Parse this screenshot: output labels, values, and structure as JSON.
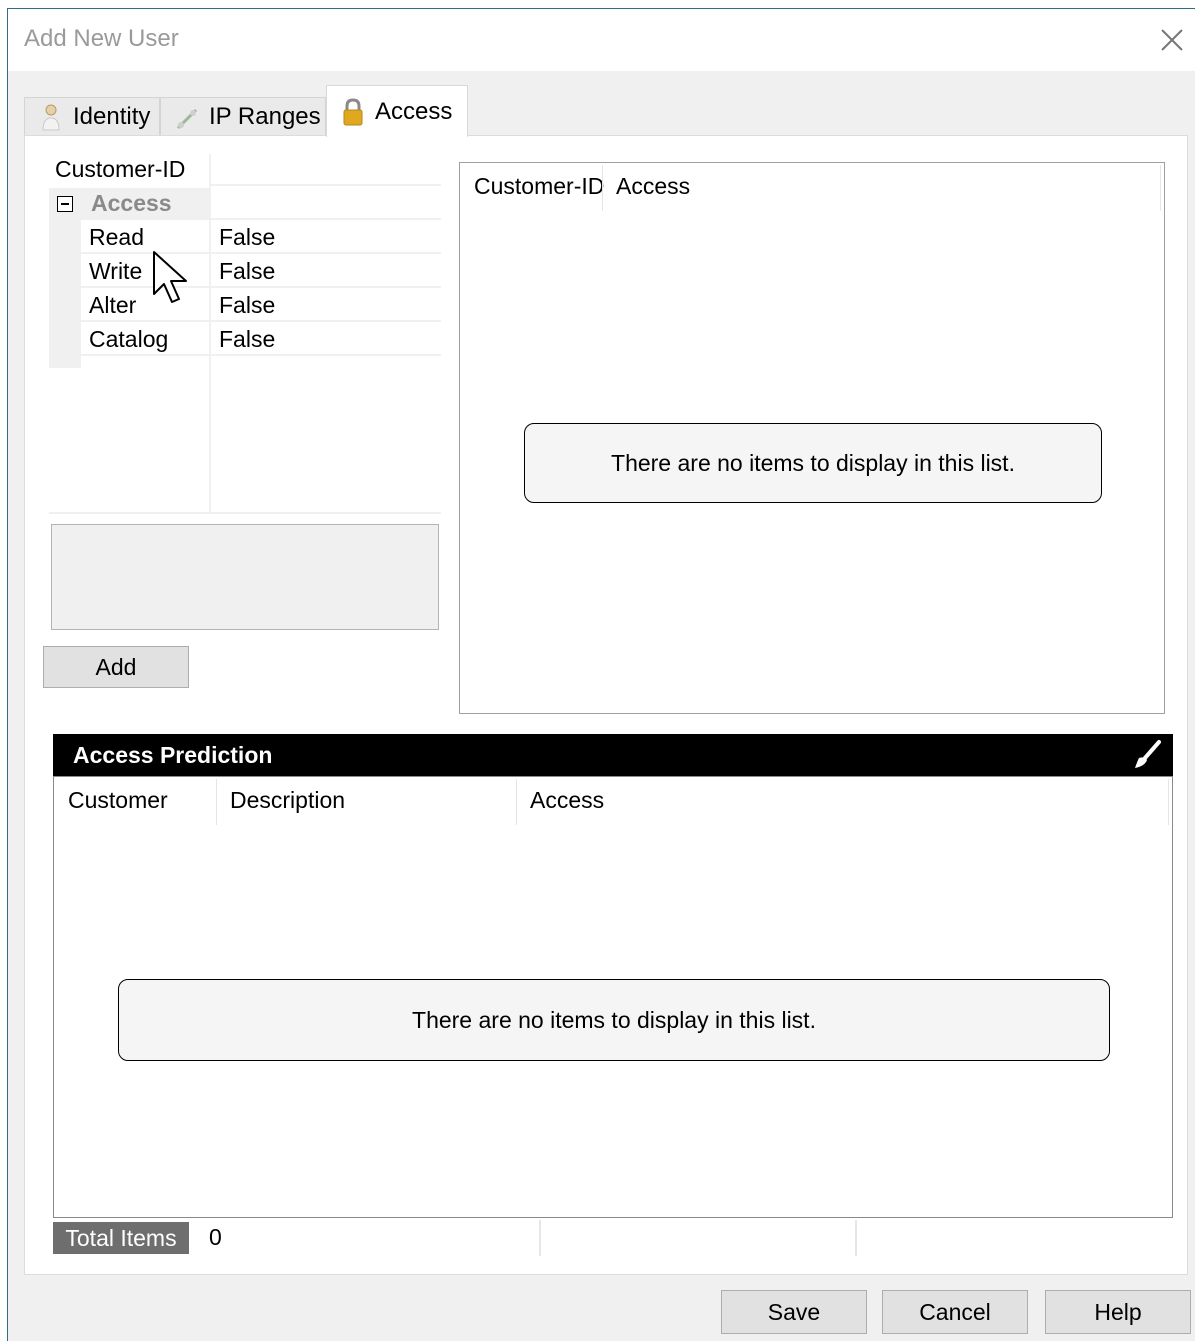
{
  "window": {
    "title": "Add New User"
  },
  "tabs": [
    {
      "label": "Identity",
      "icon": "person-icon"
    },
    {
      "label": "IP Ranges",
      "icon": "network-icon"
    },
    {
      "label": "Access",
      "icon": "lock-icon",
      "active": true
    }
  ],
  "property_grid": {
    "header": "Customer-ID",
    "category": "Access",
    "rows": [
      {
        "name": "Read",
        "value": "False"
      },
      {
        "name": "Write",
        "value": "False"
      },
      {
        "name": "Alter",
        "value": "False"
      },
      {
        "name": "Catalog",
        "value": "False"
      }
    ]
  },
  "add_button": "Add",
  "access_list": {
    "columns": [
      "Customer-ID",
      "Access"
    ],
    "empty_text": "There are no items to display in this list."
  },
  "prediction": {
    "title": "Access Prediction",
    "columns": [
      "Customer",
      "Description",
      "Access"
    ],
    "empty_text": "There are no items to display in this list."
  },
  "status": {
    "total_items_label": "Total Items",
    "total_items_value": "0"
  },
  "footer": {
    "save": "Save",
    "cancel": "Cancel",
    "help": "Help"
  }
}
